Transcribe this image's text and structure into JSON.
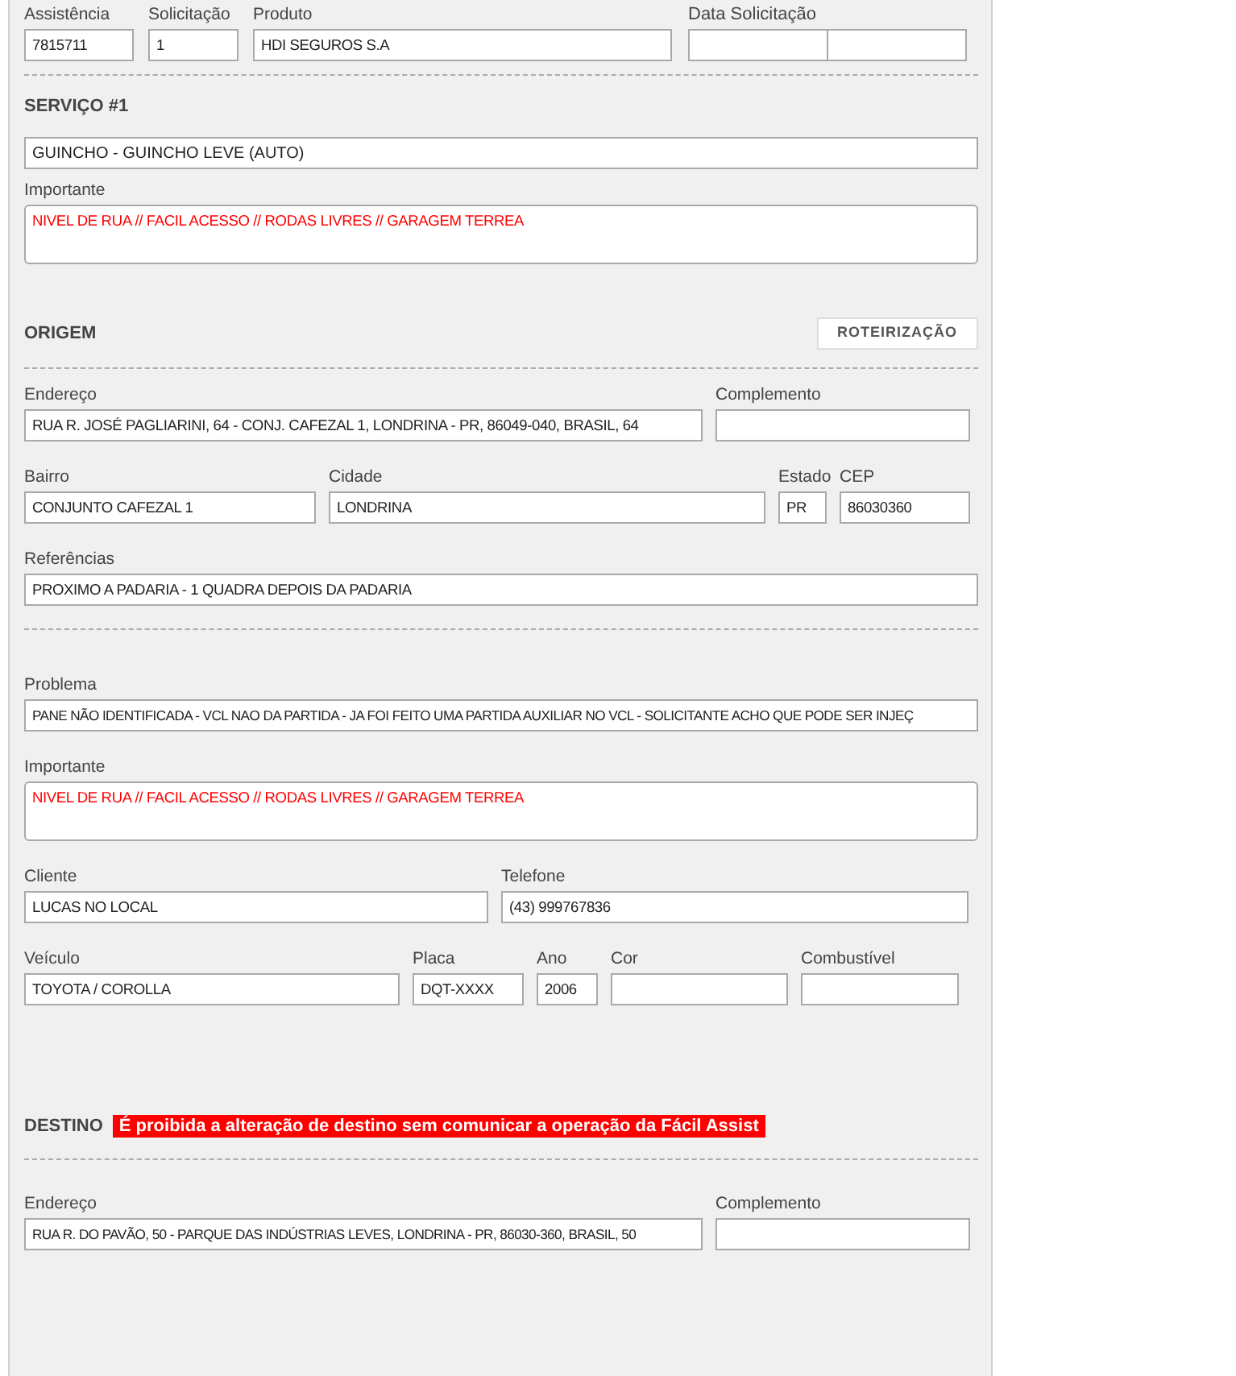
{
  "header_fields": [
    {
      "label": "Assistência",
      "value": "7815711"
    },
    {
      "label": "Solicitação",
      "value": "1"
    },
    {
      "label": "Produto",
      "value": "HDI SEGUROS S.A"
    },
    {
      "label": "Data Solicitação"
    }
  ],
  "servico": {
    "title": "SERVIÇO #1",
    "service": "GUINCHO - GUINCHO LEVE (AUTO)",
    "important_label": "Importante",
    "important": "NIVEL DE RUA // FACIL ACESSO // RODAS LIVRES // GARAGEM TERREA"
  },
  "origem": {
    "title": "ORIGEM",
    "route_button": "ROTEIRIZAÇÃO",
    "address": [
      {
        "label": "Endereço",
        "value": "RUA R. JOSÉ PAGLIARINI, 64 - CONJ. CAFEZAL 1, LONDRINA - PR, 86049-040, BRASIL, 64"
      },
      {
        "label": "Complemento"
      }
    ],
    "location": [
      {
        "label": "Bairro",
        "value": "CONJUNTO CAFEZAL 1"
      },
      {
        "label": "Cidade",
        "value": "LONDRINA"
      },
      {
        "label": "Estado",
        "value": "PR"
      },
      {
        "label": "CEP",
        "value": "86030360"
      }
    ],
    "references": {
      "label": "Referências",
      "value": "PROXIMO A PADARIA - 1 QUADRA DEPOIS DA PADARIA"
    }
  },
  "problema": {
    "label": "Problema",
    "value": "PANE NÃO IDENTIFICADA - VCL NAO DA PARTIDA - JA FOI FEITO UMA PARTIDA AUXILIAR NO VCL - SOLICITANTE ACHO QUE PODE SER INJEÇ"
  },
  "importante": {
    "label": "Importante",
    "value": "NIVEL DE RUA // FACIL ACESSO // RODAS LIVRES // GARAGEM TERREA"
  },
  "contact": [
    {
      "label": "Cliente",
      "value": "LUCAS NO LOCAL"
    },
    {
      "label": "Telefone",
      "value": "(43) 999767836"
    }
  ],
  "vehicle": [
    {
      "label": "Veículo",
      "value": "TOYOTA / COROLLA"
    },
    {
      "label": "Placa",
      "value": "DQT-XXXX"
    },
    {
      "label": "Ano",
      "value": "2006"
    },
    {
      "label": "Cor"
    },
    {
      "label": "Combustível"
    }
  ],
  "destino": {
    "title": "DESTINO",
    "warning": "É proibida a alteração de destino sem comunicar a operação da Fácil Assist",
    "address": [
      {
        "label": "Endereço",
        "value": "RUA R. DO PAVÃO, 50 - PARQUE DAS INDÚSTRIAS LEVES, LONDRINA - PR, 86030-360, BRASIL, 50"
      },
      {
        "label": "Complemento"
      }
    ]
  }
}
